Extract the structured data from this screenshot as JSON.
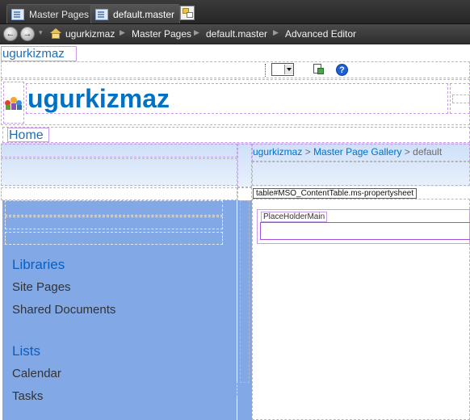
{
  "tabs": [
    {
      "label": "Master Pages",
      "active": false
    },
    {
      "label": "default.master",
      "active": true
    }
  ],
  "breadcrumb": {
    "items": [
      "ugurkizmaz",
      "Master Pages",
      "default.master",
      "Advanced Editor"
    ]
  },
  "design": {
    "top_site_name": "ugurkizmaz",
    "site_title": "ugurkizmaz",
    "home_link": "Home",
    "page_breadcrumb": {
      "site": "ugurkizmaz",
      "separator": ">",
      "gallery": "Master Page Gallery",
      "page": "default"
    },
    "content_table_label": "table#MSO_ContentTable.ms-propertysheet",
    "placeholder_label": "PlaceHolderMain"
  },
  "quick_launch": {
    "sections": [
      {
        "heading": "Libraries",
        "items": [
          "Site Pages",
          "Shared Documents"
        ]
      },
      {
        "heading": "Lists",
        "items": [
          "Calendar",
          "Tasks"
        ]
      }
    ]
  },
  "colors": {
    "accent": "#0072c6",
    "quicklaunch_bg": "#82a8e6",
    "design_border": "#c79ce8"
  }
}
